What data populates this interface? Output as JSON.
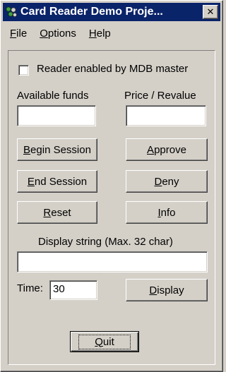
{
  "window": {
    "title": "Card Reader Demo Proje...",
    "close_glyph": "✕"
  },
  "menu": [
    {
      "key": "F",
      "rest": "ile"
    },
    {
      "key": "O",
      "rest": "ptions"
    },
    {
      "key": "H",
      "rest": "elp"
    }
  ],
  "reader_enabled": {
    "label": "Reader enabled by MDB master",
    "checked": false
  },
  "funds": {
    "label": "Available funds",
    "value": ""
  },
  "price": {
    "label": "Price / Revalue",
    "value": ""
  },
  "buttons": {
    "begin_session": {
      "key": "B",
      "rest": "egin Session"
    },
    "approve": {
      "key": "A",
      "rest": "pprove"
    },
    "end_session": {
      "key": "E",
      "rest": "nd Session"
    },
    "deny": {
      "key": "D",
      "rest": "eny"
    },
    "reset": {
      "key": "R",
      "rest": "eset"
    },
    "info": {
      "key": "I",
      "rest": "nfo"
    },
    "display": {
      "key": "D",
      "rest": "isplay"
    },
    "quit": {
      "key": "Q",
      "rest": "uit"
    }
  },
  "display_string": {
    "label": "Display string (Max. 32 char)",
    "value": ""
  },
  "time": {
    "label": "Time:",
    "value": "30"
  },
  "colors": {
    "titlebar": "#0a246a",
    "face": "#d4d0c8"
  }
}
